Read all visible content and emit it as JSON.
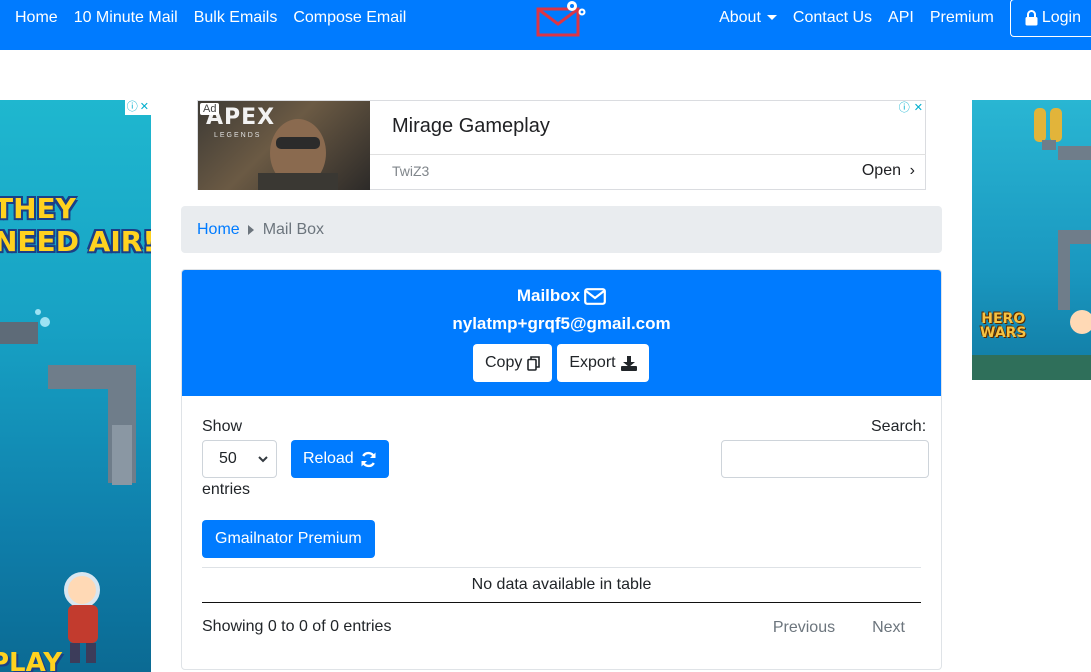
{
  "navbar": {
    "left_links": [
      "Home",
      "10 Minute Mail",
      "Bulk Emails",
      "Compose Email"
    ],
    "about_label": "About",
    "contact_label": "Contact Us",
    "api_label": "API",
    "premium_label": "Premium",
    "login_label": "Login",
    "brand_color": "#007bff"
  },
  "side_ads": {
    "left": {
      "headline": "THEY\nNEED AIR!",
      "cta": "PLAY"
    },
    "right": {
      "brand": "HERO\nWARS"
    }
  },
  "top_ad": {
    "badge": "Ad",
    "image_title": "APEX",
    "image_subtitle": "LEGENDS",
    "title": "Mirage Gameplay",
    "source": "TwiZ3",
    "open_label": "Open"
  },
  "breadcrumb": {
    "home": "Home",
    "current": "Mail Box"
  },
  "mailbox": {
    "title": "Mailbox",
    "email": "nylatmp+grqf5@gmail.com",
    "copy_label": "Copy",
    "export_label": "Export"
  },
  "table": {
    "show_label": "Show",
    "entries_value": "50",
    "entries_label": "entries",
    "reload_label": "Reload",
    "search_label": "Search:",
    "search_value": "",
    "premium_label": "Gmailnator Premium",
    "empty_message": "No data available in table",
    "info": "Showing 0 to 0 of 0 entries",
    "prev_label": "Previous",
    "next_label": "Next"
  }
}
